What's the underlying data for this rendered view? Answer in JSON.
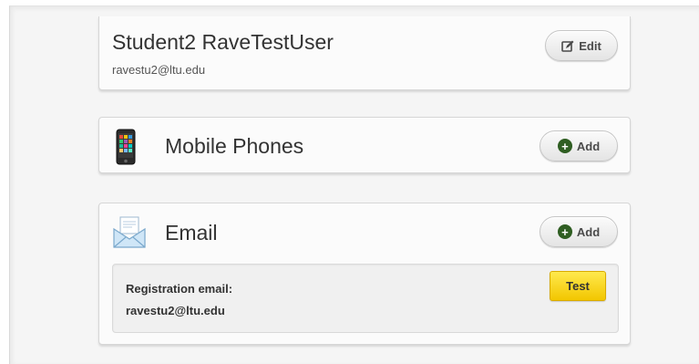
{
  "profile": {
    "name": "Student2 RaveTestUser",
    "email": "ravestu2@ltu.edu",
    "edit_label": "Edit",
    "edit_icon": "edit-icon"
  },
  "mobile_phones": {
    "title": "Mobile Phones",
    "icon": "phone-icon",
    "add_label": "Add",
    "add_icon": "plus-icon"
  },
  "email_section": {
    "title": "Email",
    "icon": "envelope-icon",
    "add_label": "Add",
    "add_icon": "plus-icon",
    "registration_label": "Registration email:",
    "registration_value": "ravestu2@ltu.edu",
    "test_label": "Test"
  },
  "colors": {
    "test_button": "#f7d417",
    "add_icon": "#2f5e22"
  }
}
